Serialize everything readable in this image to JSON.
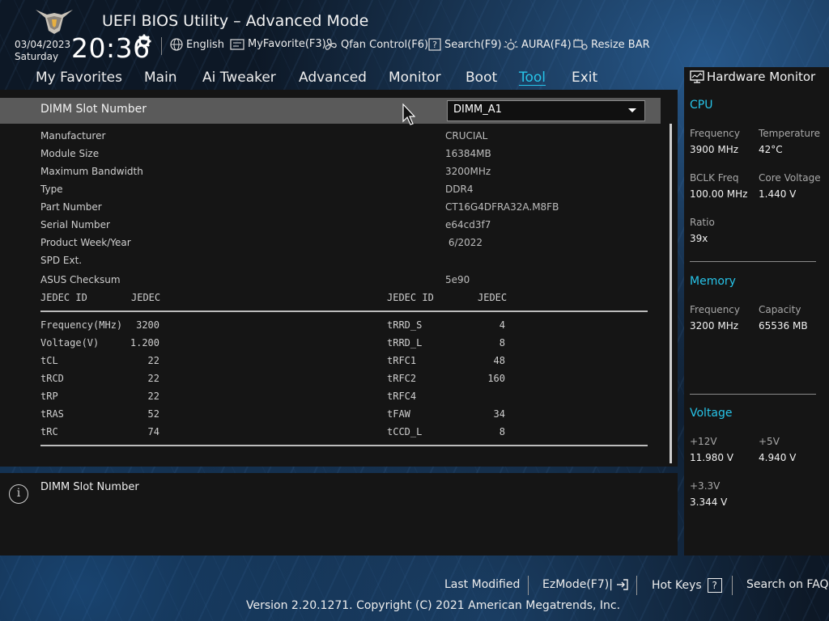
{
  "header": {
    "title": "UEFI BIOS Utility – Advanced Mode",
    "date": "03/04/2023",
    "day": "Saturday",
    "time": "20:36",
    "toolbar": [
      {
        "label": "English",
        "icon": "globe-icon"
      },
      {
        "label": "MyFavorite(F3)",
        "icon": "favorite-icon"
      },
      {
        "label": "Qfan Control(F6)",
        "icon": "fan-icon"
      },
      {
        "label": "Search(F9)",
        "icon": "search-icon"
      },
      {
        "label": "AURA(F4)",
        "icon": "aura-icon"
      },
      {
        "label": "Resize BAR",
        "icon": "resize-bar-icon"
      }
    ]
  },
  "nav": {
    "tabs": [
      "My Favorites",
      "Main",
      "Ai Tweaker",
      "Advanced",
      "Monitor",
      "Boot",
      "Tool",
      "Exit"
    ],
    "active": "Tool"
  },
  "main": {
    "slot_label": "DIMM Slot Number",
    "slot_value": "DIMM_A1",
    "info": [
      {
        "label": "Manufacturer",
        "value": "CRUCIAL"
      },
      {
        "label": "Module Size",
        "value": "16384MB"
      },
      {
        "label": "Maximum Bandwidth",
        "value": "3200MHz"
      },
      {
        "label": "Type",
        "value": "DDR4"
      },
      {
        "label": "Part Number",
        "value": "CT16G4DFRA32A.M8FB"
      },
      {
        "label": "Serial Number",
        "value": "e64cd3f7"
      },
      {
        "label": "Product Week/Year",
        "value": " 6/2022"
      },
      {
        "label": "SPD Ext.",
        "value": ""
      },
      {
        "label": "ASUS Checksum",
        "value": "5e90"
      }
    ],
    "timing_header": {
      "left_id": "JEDEC ID",
      "left_val": "JEDEC",
      "right_id": "JEDEC ID",
      "right_val": "JEDEC"
    },
    "timings_left": [
      {
        "name": "Frequency(MHz)",
        "value": "3200"
      },
      {
        "name": "Voltage(V)",
        "value": "1.200"
      },
      {
        "name": "tCL",
        "value": "22"
      },
      {
        "name": "tRCD",
        "value": "22"
      },
      {
        "name": "tRP",
        "value": "22"
      },
      {
        "name": "tRAS",
        "value": "52"
      },
      {
        "name": "tRC",
        "value": "74"
      }
    ],
    "timings_right": [
      {
        "name": "tRRD_S",
        "value": "4"
      },
      {
        "name": "tRRD_L",
        "value": "8"
      },
      {
        "name": "tRFC1",
        "value": "48"
      },
      {
        "name": "tRFC2",
        "value": "160"
      },
      {
        "name": "tRFC4",
        "value": ""
      },
      {
        "name": "tFAW",
        "value": "34"
      },
      {
        "name": "tCCD_L",
        "value": "8"
      }
    ]
  },
  "help": {
    "text": "DIMM Slot Number"
  },
  "hw": {
    "title": "Hardware Monitor",
    "cpu": {
      "heading": "CPU",
      "freq_label": "Frequency",
      "freq": "3900 MHz",
      "temp_label": "Temperature",
      "temp": "42°C",
      "bclk_label": "BCLK Freq",
      "bclk": "100.00 MHz",
      "vcore_label": "Core Voltage",
      "vcore": "1.440 V",
      "ratio_label": "Ratio",
      "ratio": "39x"
    },
    "memory": {
      "heading": "Memory",
      "freq_label": "Frequency",
      "freq": "3200 MHz",
      "cap_label": "Capacity",
      "cap": "65536 MB"
    },
    "voltage": {
      "heading": "Voltage",
      "v12_label": "+12V",
      "v12": "11.980 V",
      "v5_label": "+5V",
      "v5": "4.940 V",
      "v33_label": "+3.3V",
      "v33": "3.344 V"
    }
  },
  "footer": {
    "last_modified": "Last Modified",
    "ezmode": "EzMode(F7)|",
    "hotkeys": "Hot Keys",
    "hotkeys_key": "?",
    "faq": "Search on FAQ",
    "copyright": "Version 2.20.1271. Copyright (C) 2021 American Megatrends, Inc."
  },
  "colors": {
    "accent": "#27c4e9",
    "panel": "#151515",
    "selected_row": "#5a5a5a"
  }
}
